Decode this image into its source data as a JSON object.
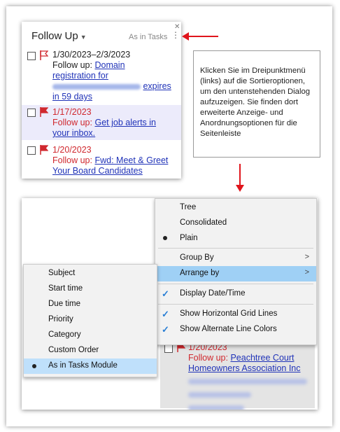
{
  "panel": {
    "title": "Follow Up",
    "sort_label": "As in Tasks",
    "items": [
      {
        "date": "1/30/2023–2/3/2023",
        "prefix": "Follow up:",
        "link1": "Domain",
        "link2": "registration for",
        "link4": "expires",
        "link5": "in 59 days"
      },
      {
        "date": "1/17/2023",
        "prefix": "Follow up:",
        "link1": "Get job alerts in",
        "link2": "your inbox."
      },
      {
        "date": "1/20/2023",
        "prefix": "Follow up:",
        "link1": "Fwd: Meet & Greet",
        "link2": "Your Board Candidates"
      }
    ]
  },
  "callout": {
    "text": "Klicken Sie im Dreipunktmenü (links) auf die Sortieroptionen, um den untenstehenden Dialog aufzuzeigen. Sie finden dort erweiterte Anzeige- und Anordnungsoptionen für die Seitenleiste"
  },
  "menu": {
    "items": [
      "Tree",
      "Consolidated",
      "Plain",
      "Group By",
      "Arrange by",
      "Display Date/Time",
      "Show Horizontal Grid Lines",
      "Show Alternate Line Colors"
    ]
  },
  "submenu": {
    "items": [
      "Subject",
      "Start time",
      "Due time",
      "Priority",
      "Category",
      "Custom Order",
      "As in Tasks Module"
    ]
  },
  "bottom_item": {
    "date": "1/20/2023",
    "prefix": "Follow up:",
    "link1": "Peachtree Court",
    "link2": "Homeowners Association Inc"
  },
  "colors": {
    "accent_red": "#d0282e",
    "link": "#2033b8",
    "highlight": "#9fd0f5"
  }
}
